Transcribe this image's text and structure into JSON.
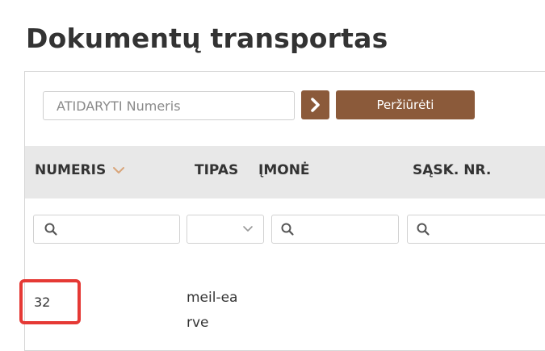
{
  "page": {
    "title": "Dokumentų transportas"
  },
  "toolbar": {
    "open_placeholder": "ATIDARYTI Numeris",
    "view_label": "Peržiūrėti"
  },
  "table": {
    "columns": [
      {
        "label": "NUMERIS",
        "sorted": true
      },
      {
        "label": "TIPAS"
      },
      {
        "label": "ĮMONĖ"
      },
      {
        "label": "SĄSK. NR."
      }
    ],
    "rows": [
      {
        "number": "32",
        "type": "meil-earve",
        "company": "",
        "invoice_no": ""
      }
    ]
  },
  "colors": {
    "button": "#8b5a3a",
    "header_bg": "#e8e8e8",
    "highlight": "#e53935",
    "sort_arrow": "#d9a57a"
  }
}
